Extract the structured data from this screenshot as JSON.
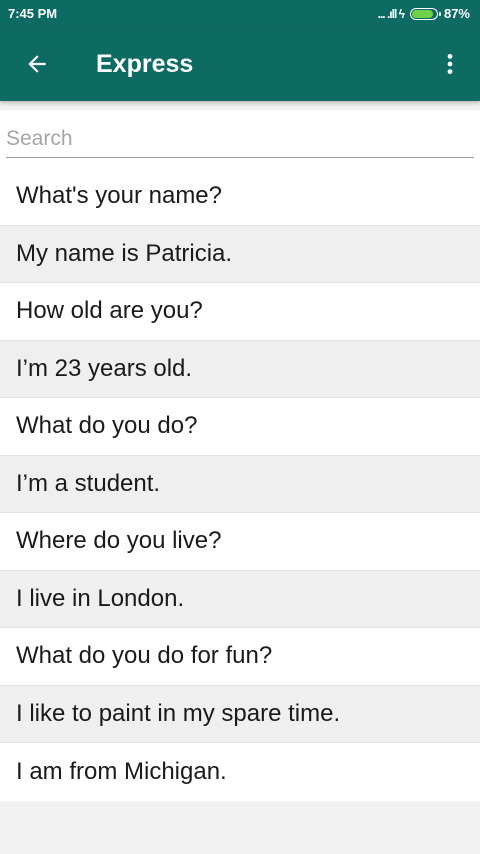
{
  "status_bar": {
    "time": "7:45 PM",
    "signal_icons": "... .ıll ϟ",
    "battery_percent": "87%",
    "battery_level": 0.87,
    "battery_color": "#6fd14a"
  },
  "app_bar": {
    "title": "Express",
    "back_icon": "arrow-left-icon",
    "menu_icon": "more-vert-icon",
    "color": "#0e6b63"
  },
  "search": {
    "placeholder": "Search",
    "value": ""
  },
  "phrases": [
    "What's your name?",
    "My name is Patricia.",
    "How old are you?",
    "I’m 23 years old.",
    "What do you do?",
    "I’m a student.",
    "Where do you live?",
    "I live in London.",
    "What do you do for fun?",
    "I like to paint in my spare time.",
    "I am from Michigan."
  ]
}
